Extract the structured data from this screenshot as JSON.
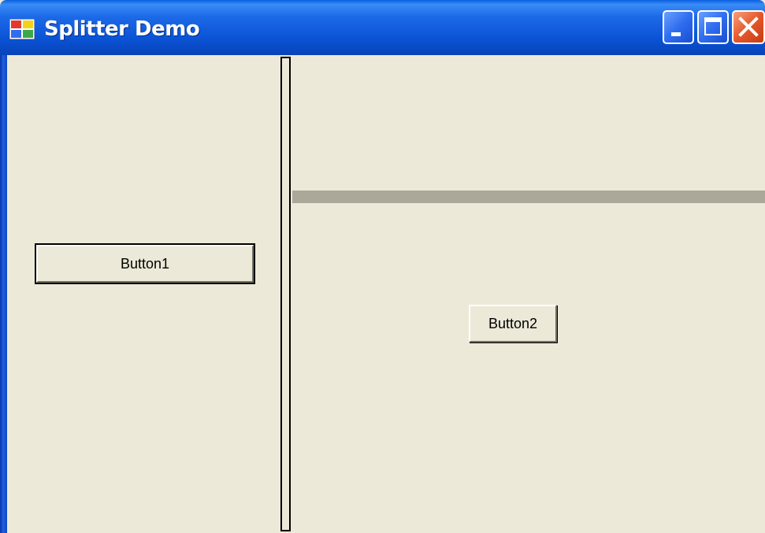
{
  "window": {
    "title": "Splitter Demo",
    "icon": "app-window-icon",
    "controls": [
      "minimize-icon",
      "maximize-icon",
      "close-icon"
    ]
  },
  "left_panel": {
    "button_label": "Button1"
  },
  "right_panel": {
    "button_label": "Button2"
  },
  "colors": {
    "titlebar": "#0a53d6",
    "client_background": "#ece9d8",
    "horizontal_splitter": "#aca899",
    "close_button": "#e5572b"
  }
}
